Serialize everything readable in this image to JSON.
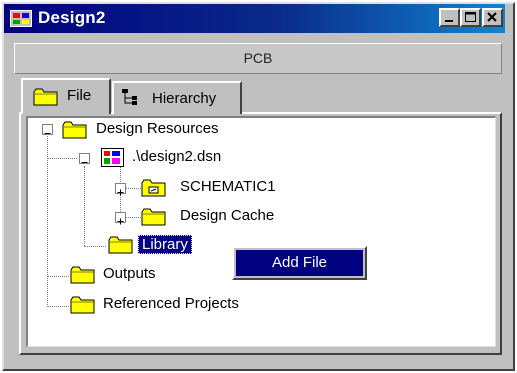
{
  "window": {
    "title": "Design2",
    "app_icon": "orcad-app-icon",
    "controls": {
      "minimize_icon": "minimize-icon",
      "maximize_icon": "maximize-icon",
      "close_icon": "close-icon"
    }
  },
  "header": {
    "label": "PCB"
  },
  "tabs": [
    {
      "label": "File",
      "icon": "folder-icon",
      "active": true
    },
    {
      "label": "Hierarchy",
      "icon": "hierarchy-icon",
      "active": false
    }
  ],
  "tree": {
    "root": {
      "label": "Design Resources",
      "expanded": true
    },
    "design_file": {
      "label": ".\\design2.dsn",
      "expanded": true
    },
    "schematic": {
      "label": "SCHEMATIC1",
      "expanded": false
    },
    "design_cache": {
      "label": "Design Cache",
      "expanded": false
    },
    "library": {
      "label": "Library",
      "selected": true
    },
    "outputs": {
      "label": "Outputs"
    },
    "referenced_projects": {
      "label": "Referenced Projects"
    }
  },
  "context_menu": {
    "items": [
      {
        "label": "Add File",
        "highlighted": true
      }
    ]
  },
  "colors": {
    "title_bar": "#000080",
    "selection": "#000080",
    "folder": "#ffff00",
    "window_face": "#c0c0c0"
  }
}
